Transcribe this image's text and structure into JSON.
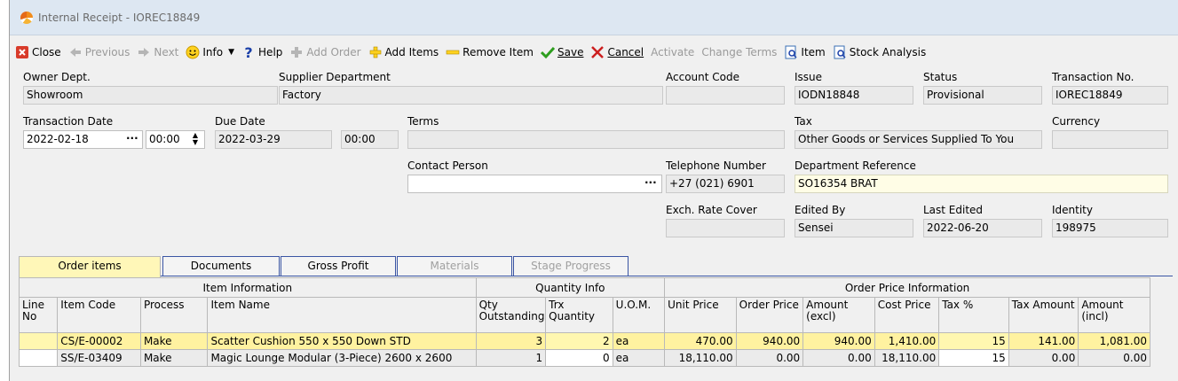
{
  "window": {
    "title": "Internal Receipt - IOREC18849"
  },
  "toolbar": {
    "close": "Close",
    "previous": "Previous",
    "next": "Next",
    "info": "Info",
    "help": "Help",
    "add_order": "Add Order",
    "add_items": "Add Items",
    "remove_item": "Remove Item",
    "save": "Save",
    "cancel": "Cancel",
    "activate": "Activate",
    "change_terms": "Change Terms",
    "item": "Item",
    "stock_analysis": "Stock Analysis"
  },
  "form": {
    "owner_dept": {
      "label": "Owner Dept.",
      "value": "Showroom"
    },
    "supplier_department": {
      "label": "Supplier Department",
      "value": "Factory"
    },
    "account_code": {
      "label": "Account Code",
      "value": ""
    },
    "issue": {
      "label": "Issue",
      "value": "IODN18848"
    },
    "status": {
      "label": "Status",
      "value": "Provisional"
    },
    "transaction_no": {
      "label": "Transaction No.",
      "value": "IOREC18849"
    },
    "transaction_date": {
      "label": "Transaction Date",
      "value": "2022-02-18",
      "time": "00:00"
    },
    "due_date": {
      "label": "Due Date",
      "value": "2022-03-29",
      "time": "00:00"
    },
    "terms": {
      "label": "Terms",
      "value": ""
    },
    "tax": {
      "label": "Tax",
      "value": "Other Goods or Services Supplied To You"
    },
    "currency": {
      "label": "Currency",
      "value": ""
    },
    "contact_person": {
      "label": "Contact Person",
      "value": ""
    },
    "telephone_number": {
      "label": "Telephone Number",
      "value": "+27 (021) 6901"
    },
    "department_reference": {
      "label": "Department Reference",
      "value": "SO16354 BRAT"
    },
    "exch_rate_cover": {
      "label": "Exch. Rate Cover",
      "value": ""
    },
    "edited_by": {
      "label": "Edited By",
      "value": "Sensei"
    },
    "last_edited": {
      "label": "Last Edited",
      "value": "2022-06-20"
    },
    "identity": {
      "label": "Identity",
      "value": "198975"
    }
  },
  "tabs": [
    {
      "label": "Order items",
      "active": true
    },
    {
      "label": "Documents"
    },
    {
      "label": "Gross Profit"
    },
    {
      "label": "Materials",
      "disabled": true
    },
    {
      "label": "Stage Progress",
      "disabled": true
    }
  ],
  "grid": {
    "groups": {
      "item_information": "Item Information",
      "quantity_info": "Quantity Info",
      "order_price_information": "Order Price Information"
    },
    "columns": {
      "line_no": "Line No",
      "item_code": "Item Code",
      "process": "Process",
      "item_name": "Item Name",
      "qty_outstanding": "Qty Outstanding",
      "trx_quantity": "Trx Quantity",
      "uom": "U.O.M.",
      "unit_price": "Unit Price",
      "order_price": "Order Price",
      "amount_excl": "Amount (excl)",
      "cost_price": "Cost Price",
      "tax_pct": "Tax %",
      "tax_amount": "Tax Amount",
      "amount_incl": "Amount (incl)"
    },
    "rows": [
      {
        "line_no": "",
        "item_code": "CS/E-00002",
        "process": "Make",
        "item_name": "Scatter Cushion 550 x 550 Down STD",
        "qty_outstanding": "3",
        "trx_quantity": "2",
        "uom": "ea",
        "unit_price": "470.00",
        "order_price": "940.00",
        "amount_excl": "940.00",
        "cost_price": "1,410.00",
        "tax_pct": "15",
        "tax_amount": "141.00",
        "amount_incl": "1,081.00"
      },
      {
        "line_no": "",
        "item_code": "SS/E-03409",
        "process": "Make",
        "item_name": "Magic Lounge Modular (3-Piece) 2600 x 2600",
        "qty_outstanding": "1",
        "trx_quantity": "0",
        "uom": "ea",
        "unit_price": "18,110.00",
        "order_price": "0.00",
        "amount_excl": "0.00",
        "cost_price": "18,110.00",
        "tax_pct": "15",
        "tax_amount": "0.00",
        "amount_incl": "0.00"
      }
    ]
  },
  "colors": {
    "selected_row": "#fff7b0",
    "active_tab": "#fff7b8",
    "titlebar": "#dde7f2",
    "close_red": "#d83b2a",
    "save_green": "#2e9e1f",
    "cancel_red": "#cc1f1f"
  }
}
